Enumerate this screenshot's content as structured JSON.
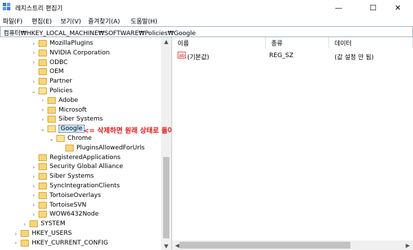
{
  "window": {
    "title": "레지스트리 편집기",
    "minimize": "—",
    "maximize": "☐",
    "close": "✕"
  },
  "menu": [
    "파일(F)",
    "편집(E)",
    "보기(V)",
    "즐겨찾기(A)",
    "도움말(H)"
  ],
  "address": "컴퓨터₩HKEY_LOCAL_MACHINE₩SOFTWARE₩Policies₩Google",
  "tree": [
    {
      "label": "MozillaPlugins",
      "indent": 1,
      "chev": ">"
    },
    {
      "label": "NVIDIA Corporation",
      "indent": 1,
      "chev": ">"
    },
    {
      "label": "ODBC",
      "indent": 1,
      "chev": ">"
    },
    {
      "label": "OEM",
      "indent": 1,
      "chev": ""
    },
    {
      "label": "Partner",
      "indent": 1,
      "chev": ">"
    },
    {
      "label": "Policies",
      "indent": 1,
      "chev": "v"
    },
    {
      "label": "Adobe",
      "indent": 2,
      "chev": ">"
    },
    {
      "label": "Microsoft",
      "indent": 2,
      "chev": ">"
    },
    {
      "label": "Siber Systems",
      "indent": 2,
      "chev": ">"
    },
    {
      "label": "Google",
      "indent": 2,
      "chev": "v",
      "selected": true
    },
    {
      "label": "Chrome",
      "indent": 3,
      "chev": "v"
    },
    {
      "label": "PluginsAllowedForUrls",
      "indent": 4,
      "chev": ""
    },
    {
      "label": "RegisteredApplications",
      "indent": 1,
      "chev": ""
    },
    {
      "label": "Security Global Alliance",
      "indent": 1,
      "chev": ">"
    },
    {
      "label": "Siber Systems",
      "indent": 1,
      "chev": ">"
    },
    {
      "label": "SyncIntegrationClients",
      "indent": 1,
      "chev": ">"
    },
    {
      "label": "TortoiseOverlays",
      "indent": 1,
      "chev": ">"
    },
    {
      "label": "TortoiseSVN",
      "indent": 1,
      "chev": ">"
    },
    {
      "label": "WOW6432Node",
      "indent": 1,
      "chev": ">"
    },
    {
      "label": "SYSTEM",
      "indent": 0,
      "chev": ">"
    },
    {
      "label": "HKEY_USERS",
      "indent": -1,
      "chev": ">"
    },
    {
      "label": "HKEY_CURRENT_CONFIG",
      "indent": -1,
      "chev": ">"
    }
  ],
  "annotation": "<= 삭제하면 원래 상태로 돌아감",
  "columns": {
    "name": "이름",
    "type": "종류",
    "data": "데이터"
  },
  "values": [
    {
      "icon": "ab",
      "name": "(기본값)",
      "type": "REG_SZ",
      "data": "(값 설정 안 됨)"
    }
  ]
}
